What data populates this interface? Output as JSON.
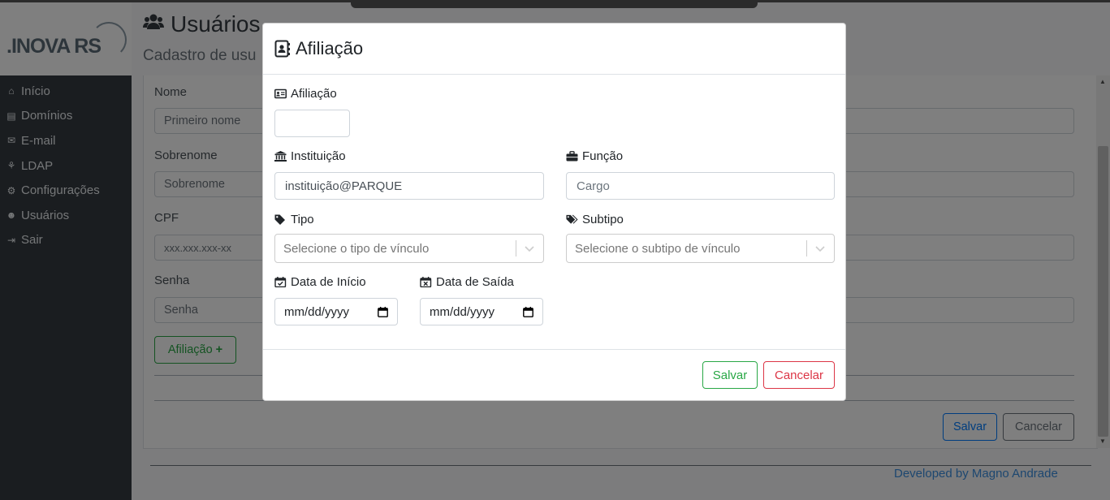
{
  "app": {
    "logo_text": ".INOVA RS"
  },
  "sidebar": {
    "items": [
      {
        "label": "Início",
        "icon": "home-icon"
      },
      {
        "label": "Domínios",
        "icon": "book-icon"
      },
      {
        "label": "E-mail",
        "icon": "envelope-icon"
      },
      {
        "label": "LDAP",
        "icon": "sitemap-icon"
      },
      {
        "label": "Configurações",
        "icon": "gears-icon"
      },
      {
        "label": "Usuários",
        "icon": "users-icon"
      },
      {
        "label": "Sair",
        "icon": "sign-out-icon"
      }
    ]
  },
  "page": {
    "title": "Usuários",
    "subtitle": "Cadastro de usu",
    "form": {
      "nome_label": "Nome",
      "nome_placeholder": "Primeiro nome",
      "sobrenome_label": "Sobrenome",
      "sobrenome_placeholder": "Sobrenome",
      "cpf_label": "CPF",
      "cpf_placeholder": "xxx.xxx.xxx-xx",
      "senha_label": "Senha",
      "senha_placeholder": "Senha",
      "afiliacao_button": "Afiliação",
      "save_label": "Salvar",
      "cancel_label": "Cancelar"
    },
    "footer": "Developed by Magno Andrade"
  },
  "modal": {
    "title": "Afiliação",
    "afiliacao_label": "Afiliação",
    "afiliacao_value": "",
    "instituicao_label": "Instituição",
    "instituicao_value": "instituição@PARQUE",
    "funcao_label": "Função",
    "funcao_placeholder": "Cargo",
    "tipo_label": "Tipo",
    "tipo_placeholder": "Selecione o tipo de vínculo",
    "subtipo_label": "Subtipo",
    "subtipo_placeholder": "Selecione o subtipo de vínculo",
    "data_inicio_label": "Data de Início",
    "data_inicio_value": "mm/dd/yyyy",
    "data_saida_label": "Data de Saída",
    "data_saida_value": "mm/dd/yyyy",
    "save_label": "Salvar",
    "cancel_label": "Cancelar"
  },
  "colors": {
    "success": "#28a745",
    "danger": "#dc3545",
    "primary": "#007bff",
    "sidebar": "#343a40"
  }
}
